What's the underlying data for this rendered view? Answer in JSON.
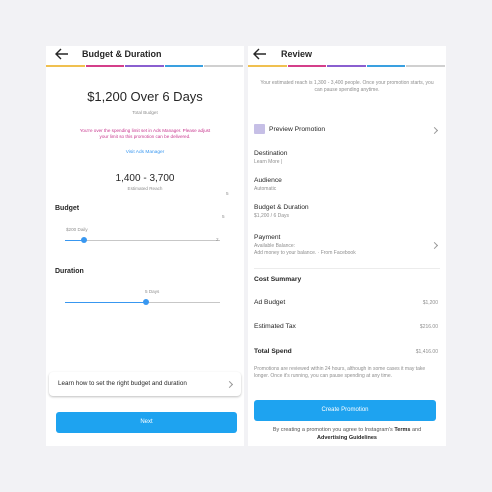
{
  "left": {
    "title": "Budget & Duration",
    "stripe_colors": [
      "#f0c050",
      "#d43f8a",
      "#8a5fd0",
      "#3aa0e0",
      "#d0d0d0"
    ],
    "headline": "$1,200 Over 6 Days",
    "total_budget_label": "Total Budget",
    "warning": "You're over the spending limit set in Ads Manager. Please adjust your limit so this promotion can be delivered.",
    "visit_link": "Visit Ads Manager",
    "reach_value": "1,400 - 3,700",
    "reach_label": "Estimated Reach",
    "side_marker_1": "5",
    "side_marker_2": "5",
    "budget_heading": "Budget",
    "budget_value_label": "$200 Daily",
    "budget_end_marker": "2",
    "budget_level": 0.12,
    "duration_heading": "Duration",
    "duration_value_label": "5 Days",
    "duration_level": 0.52,
    "learn_text": "Learn how to set the right budget and duration",
    "next_label": "Next"
  },
  "right": {
    "title": "Review",
    "reach_text": "Your estimated reach is 1,300 - 3,400 people. Once your promotion starts, you can pause spending anytime.",
    "preview_label": "Preview Promotion",
    "destination_label": "Destination",
    "destination_value": "Learn More |",
    "audience_label": "Audience",
    "audience_value": "Automatic",
    "budget_label": "Budget & Duration",
    "budget_value": "$1,200 / 6 Days",
    "payment_label": "Payment",
    "payment_line1": "Available Balance:",
    "payment_line2": "Add money to your balance. · From Facebook",
    "cost_summary": "Cost Summary",
    "ad_budget_label": "Ad Budget",
    "ad_budget_value": "$1,200",
    "tax_label": "Estimated Tax",
    "tax_value": "$216.00",
    "total_label": "Total Spend",
    "total_value": "$1,416.00",
    "review_note": "Promotions are reviewed within 24 hours, although in some cases it may take longer. Once it's running, you can pause spending at any time.",
    "create_label": "Create Promotion",
    "terms_prefix": "By creating a promotion you agree to Instagram's",
    "terms_link": "Terms",
    "terms_and": "and",
    "guidelines_link": "Advertising Guidelines"
  }
}
